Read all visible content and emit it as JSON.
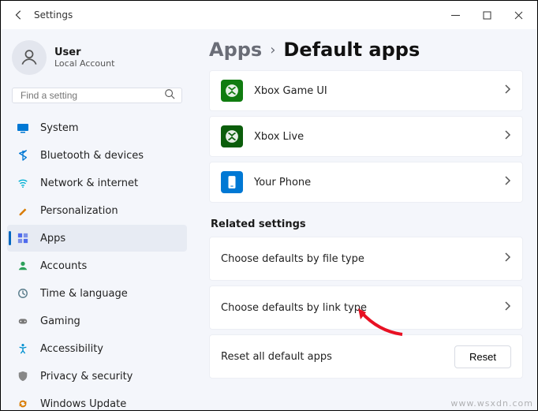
{
  "window": {
    "title": "Settings"
  },
  "profile": {
    "name": "User",
    "subtitle": "Local Account"
  },
  "search": {
    "placeholder": "Find a setting"
  },
  "nav": {
    "items": [
      {
        "label": "System"
      },
      {
        "label": "Bluetooth & devices"
      },
      {
        "label": "Network & internet"
      },
      {
        "label": "Personalization"
      },
      {
        "label": "Apps"
      },
      {
        "label": "Accounts"
      },
      {
        "label": "Time & language"
      },
      {
        "label": "Gaming"
      },
      {
        "label": "Accessibility"
      },
      {
        "label": "Privacy & security"
      },
      {
        "label": "Windows Update"
      }
    ]
  },
  "breadcrumb": {
    "parent": "Apps",
    "current": "Default apps"
  },
  "apps": [
    {
      "label": "Xbox Game UI"
    },
    {
      "label": "Xbox Live"
    },
    {
      "label": "Your Phone"
    }
  ],
  "related": {
    "title": "Related settings",
    "items": [
      {
        "label": "Choose defaults by file type"
      },
      {
        "label": "Choose defaults by link type"
      }
    ],
    "reset": {
      "label": "Reset all default apps",
      "button": "Reset"
    }
  },
  "watermark": "www.wsxdn.com"
}
